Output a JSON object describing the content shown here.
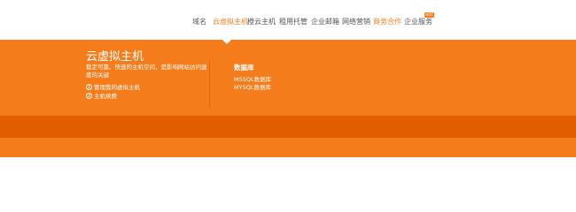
{
  "nav": {
    "items": [
      {
        "label": "域名",
        "state": "normal"
      },
      {
        "label": "云虚拟主机",
        "state": "active"
      },
      {
        "label": "橙云主机",
        "state": "normal"
      },
      {
        "label": "租用托管",
        "state": "normal"
      },
      {
        "label": "企业邮箱",
        "state": "normal"
      },
      {
        "label": "网络营销",
        "state": "normal"
      },
      {
        "label": "商务合作",
        "state": "highlight"
      },
      {
        "label": "企业服务",
        "state": "normal"
      }
    ],
    "badge": "HOT"
  },
  "panel": {
    "title": "云虚拟主机",
    "description": "稳定可靠、快速的主机空间，是影响网站访问速度的关键",
    "links": [
      {
        "num": "1",
        "label": "管理我的虚拟主机"
      },
      {
        "num": "2",
        "label": "主机续费"
      }
    ],
    "database": {
      "title": "数据库",
      "links": [
        "MSSQL数据库",
        "MYSQL数据库"
      ]
    }
  },
  "colors": {
    "accent": "#f57c1b",
    "accent_dark": "#e05e00",
    "nav_text": "#555555",
    "nav_active": "#f47c20"
  }
}
